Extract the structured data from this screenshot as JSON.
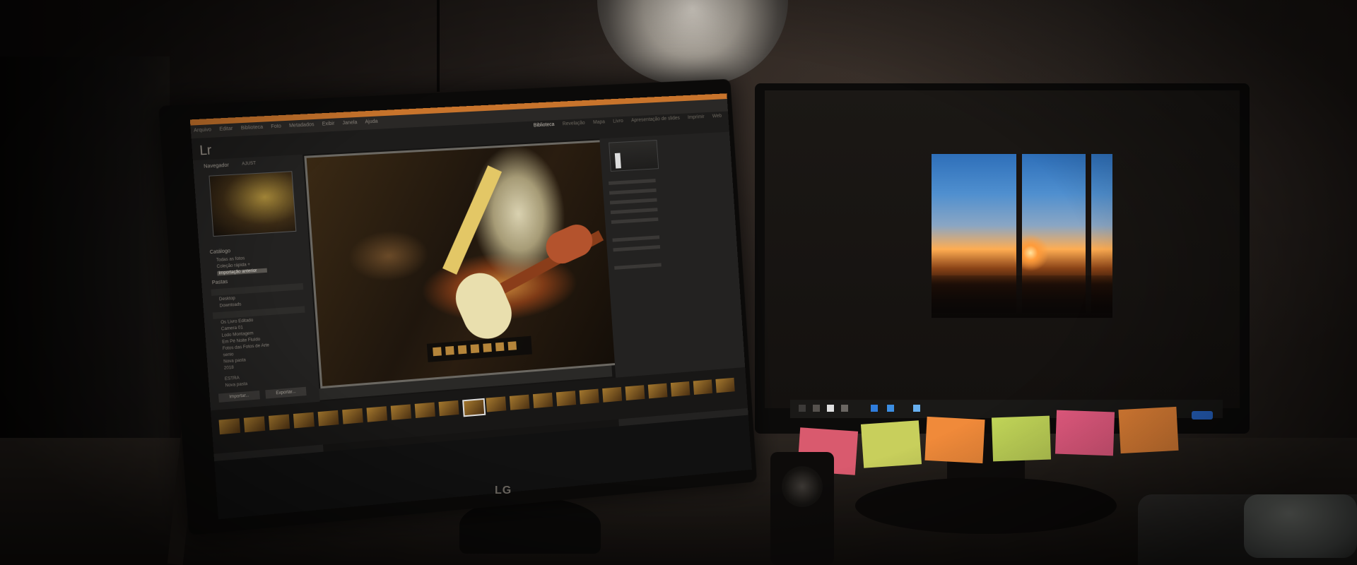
{
  "lightroom": {
    "logo": "Lr",
    "menu": [
      "Arquivo",
      "Editar",
      "Biblioteca",
      "Foto",
      "Metadados",
      "Exibir",
      "Janela",
      "Ajuda"
    ],
    "modules": [
      "Biblioteca",
      "Revelação",
      "Mapa",
      "Livro",
      "Apresentação de slides",
      "Imprimir",
      "Web"
    ],
    "navigator_label": "Navegador",
    "navigator_fit": "AJUST",
    "catalog_label": "Catálogo",
    "catalog_items": [
      "Todas as fotos",
      "Coleção rápida +",
      "Importação anterior"
    ],
    "folders_label": "Pastas",
    "folder_items": [
      "Desktop",
      "Downloads",
      "Os Livro Editado",
      "Camera 01",
      "Lodo Montagem",
      "Em Pé Noite Fluído",
      "Fotos das Fotos de Arte",
      "senio",
      "Nova pasta",
      "2018",
      "ESTRA",
      "Nova pasta"
    ],
    "import_button": "Importar...",
    "export_button": "Exportar..."
  },
  "accent_color": "#c8742c",
  "brand": "LG",
  "sticky_note_colors": [
    "#d95a6e",
    "#c8cf5c",
    "#f08a3a",
    "#c5d95a",
    "#ef5f86",
    "#f08a3a"
  ]
}
